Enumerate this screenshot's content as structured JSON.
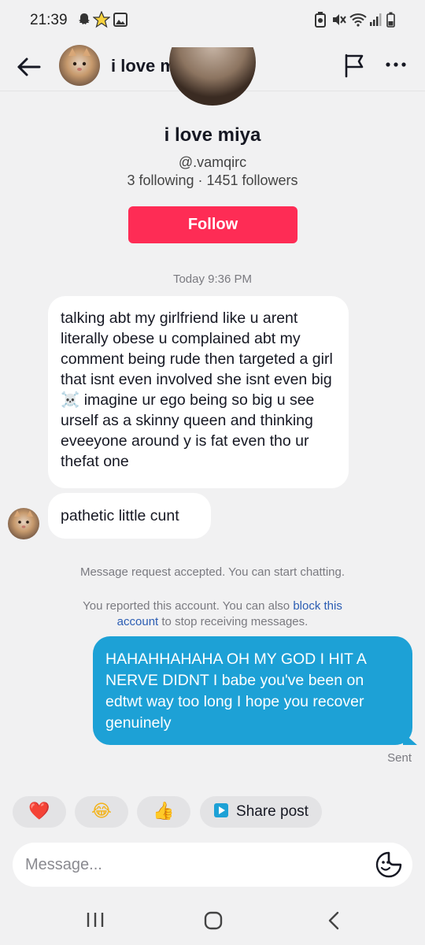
{
  "status_bar": {
    "time": "21:39",
    "left_icons": [
      "snapchat-ghost-icon",
      "star-badge-icon",
      "image-icon"
    ],
    "right_icons": [
      "battery-saver-icon",
      "mute-icon",
      "wifi-icon",
      "signal-icon",
      "battery-icon"
    ]
  },
  "header": {
    "title": "i love miya",
    "icons": [
      "back-arrow-icon",
      "flag-icon",
      "more-icon"
    ]
  },
  "profile": {
    "name": "i love miya",
    "handle": "@.vamqirc",
    "stats": "3 following · 1451 followers",
    "follow_label": "Follow"
  },
  "chat": {
    "timestamp": "Today 9:36 PM",
    "incoming": [
      "talking abt my girlfriend like u arent literally obese u complained abt my comment being rude then targeted a girl that isnt even involved she isnt even big ☠️ imagine ur ego being so big u see urself as a skinny queen and thinking eveeyone around y is fat even tho ur thefat one",
      "pathetic little cunt"
    ],
    "system_accept": "Message request accepted. You can start chatting.",
    "system_report_prefix": "You reported this account. You can also ",
    "system_report_link": "block this account",
    "system_report_suffix": " to stop receiving messages.",
    "outgoing": "HAHAHHAHAHA OH MY GOD I HIT A NERVE DIDNT I babe you've been on edtwt way too long I hope you recover genuinely",
    "sent_status": "Sent"
  },
  "quick_actions": {
    "heart": "❤️",
    "laugh": "😂",
    "thumbs": "👍",
    "share_label": "Share post"
  },
  "composer": {
    "placeholder": "Message..."
  },
  "colors": {
    "follow": "#fe2c55",
    "outgoing_bubble": "#1da1d6",
    "link": "#2b5db3",
    "background": "#f1f1f2"
  }
}
